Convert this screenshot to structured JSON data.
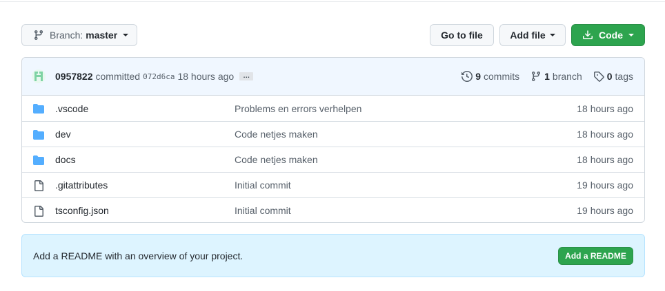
{
  "toolbar": {
    "branch_label": "Branch:",
    "branch_value": "master",
    "go_to_file": "Go to file",
    "add_file": "Add file",
    "code": "Code"
  },
  "commit": {
    "author": "0957822",
    "verb": "committed",
    "sha": "072d6ca",
    "time": "18 hours ago",
    "ellipsis": "…"
  },
  "stats": {
    "commits_count": "9",
    "commits_label": "commits",
    "branch_count": "1",
    "branch_label": "branch",
    "tags_count": "0",
    "tags_label": "tags"
  },
  "files": [
    {
      "type": "folder",
      "name": ".vscode",
      "message": "Problems en errors verhelpen",
      "age": "18 hours ago"
    },
    {
      "type": "folder",
      "name": "dev",
      "message": "Code netjes maken",
      "age": "18 hours ago"
    },
    {
      "type": "folder",
      "name": "docs",
      "message": "Code netjes maken",
      "age": "18 hours ago"
    },
    {
      "type": "file",
      "name": ".gitattributes",
      "message": "Initial commit",
      "age": "19 hours ago"
    },
    {
      "type": "file",
      "name": "tsconfig.json",
      "message": "Initial commit",
      "age": "19 hours ago"
    }
  ],
  "readme": {
    "text": "Add a README with an overview of your project.",
    "button": "Add a README"
  },
  "colors": {
    "primary_green": "#2da44e",
    "folder_blue": "#54aeff",
    "readme_bg": "#ddf4ff"
  }
}
